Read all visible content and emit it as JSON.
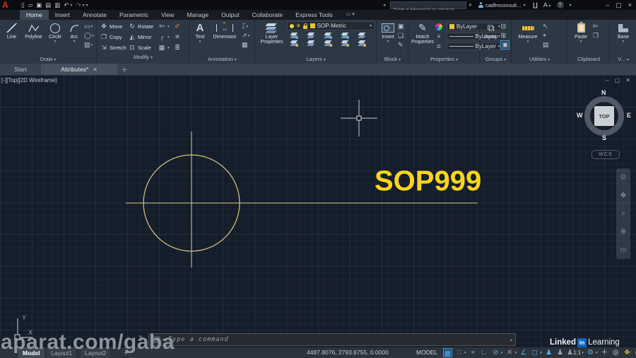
{
  "titlebar": {
    "search_placeholder": "Type a keyword or phrase",
    "account": "cadfmconsult..."
  },
  "ribbon_tabs": [
    "Home",
    "Insert",
    "Annotate",
    "Parametric",
    "View",
    "Manage",
    "Output",
    "Collaborate",
    "Express Tools"
  ],
  "panels": {
    "draw": {
      "label": "Draw",
      "line": "Line",
      "polyline": "Polyline",
      "circle": "Circle",
      "arc": "Arc"
    },
    "modify": {
      "label": "Modify",
      "move": "Move",
      "rotate": "Rotate",
      "copy": "Copy",
      "mirror": "Mirror",
      "stretch": "Stretch",
      "scale": "Scale"
    },
    "annotation": {
      "label": "Annotation",
      "text": "Text",
      "dimension": "Dimension"
    },
    "layers": {
      "label": "Layers",
      "layer_properties": "Layer Properties",
      "current_layer": "SOP-Metric"
    },
    "block": {
      "label": "Block",
      "insert": "Insert"
    },
    "properties": {
      "label": "Properties",
      "match_properties": "Match Properties",
      "color": "ByLayer",
      "lineweight": "ByLayer",
      "linetype": "ByLayer"
    },
    "groups": {
      "label": "Groups",
      "group": "Group"
    },
    "utilities": {
      "label": "Utilities",
      "measure": "Measure"
    },
    "clipboard": {
      "label": "Clipboard",
      "paste": "Paste"
    },
    "view": {
      "label": "V...",
      "base": "Base"
    }
  },
  "file_tabs": {
    "start": "Start",
    "active": "Attributes*"
  },
  "viewport": {
    "label": "[-][Top][2D Wireframe]"
  },
  "viewcube": {
    "n": "N",
    "e": "E",
    "s": "S",
    "w": "W",
    "top": "TOP",
    "wcs": "WCS"
  },
  "ucs": {
    "x": "X",
    "y": "Y"
  },
  "drawing": {
    "text": "SOP999"
  },
  "command_line": {
    "placeholder": "Type a command"
  },
  "status_bar": {
    "coordinates": "4487.8076, 2793.6755, 0.0000",
    "space": "MODEL",
    "scale": "1:1",
    "model_tab": "Model",
    "layout1_tab": "Layout1",
    "layout2_tab": "Layout2"
  },
  "watermarks": {
    "site": "aparat.com/gaba",
    "linkedin_prefix": "Linked",
    "linkedin_in": "in",
    "linkedin_suffix": "Learning"
  },
  "colors": {
    "drawing_text": "#ffd41f",
    "geometry": "#d9c87f",
    "layer_swatch": "#e8c23a",
    "accent_blue": "#56aee8",
    "linkedin_blue": "#0a66c2"
  }
}
